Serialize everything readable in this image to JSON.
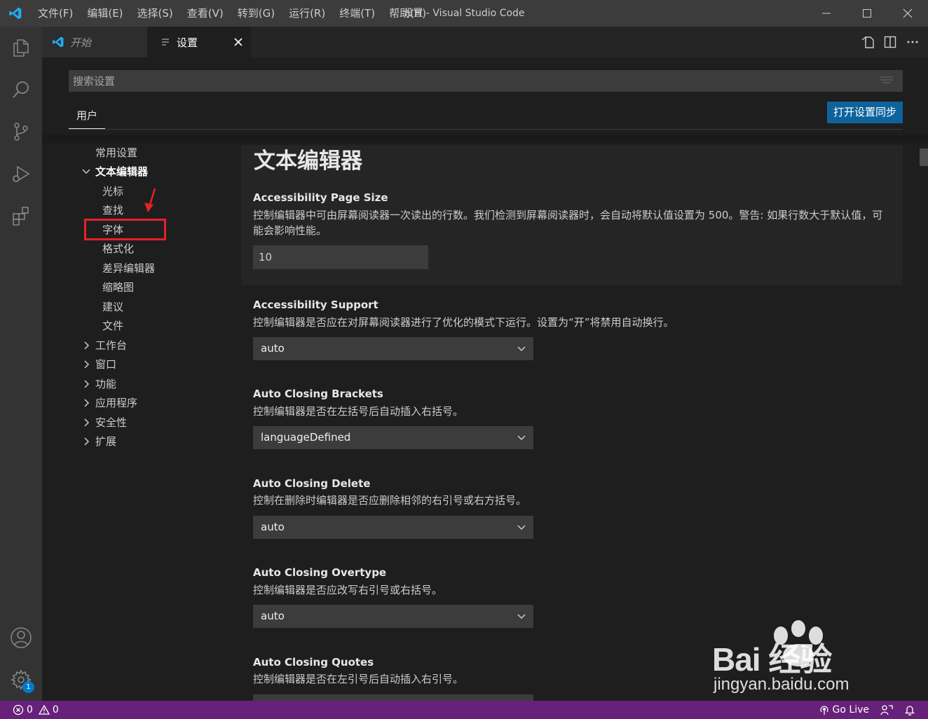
{
  "titlebar": {
    "menu": [
      "文件(F)",
      "编辑(E)",
      "选择(S)",
      "查看(V)",
      "转到(G)",
      "运行(R)",
      "终端(T)",
      "帮助(H)"
    ],
    "title": "设置 - Visual Studio Code"
  },
  "activitybar": {
    "icons": [
      "explorer-icon",
      "search-icon",
      "source-control-icon",
      "run-debug-icon",
      "extensions-icon",
      "account-icon",
      "manage-gear-icon"
    ],
    "manage_badge": "1"
  },
  "tabs": [
    {
      "label": "开始",
      "active": false
    },
    {
      "label": "设置",
      "active": true
    }
  ],
  "settings": {
    "search_placeholder": "搜索设置",
    "scope_tab": "用户",
    "sync_button": "打开设置同步",
    "toc": {
      "common": "常用设置",
      "text_editor": "文本编辑器",
      "text_editor_children": [
        "光标",
        "查找",
        "字体",
        "格式化",
        "差异编辑器",
        "缩略图",
        "建议",
        "文件"
      ],
      "collapsed": [
        "工作台",
        "窗口",
        "功能",
        "应用程序",
        "安全性",
        "扩展"
      ]
    },
    "section_title": "文本编辑器",
    "items": [
      {
        "title": "Accessibility Page Size",
        "desc": "控制编辑器中可由屏幕阅读器一次读出的行数。我们检测到屏幕阅读器时，会自动将默认值设置为 500。警告: 如果行数大于默认值，可能会影响性能。",
        "value": "10"
      },
      {
        "title": "Accessibility Support",
        "desc": "控制编辑器是否应在对屏幕阅读器进行了优化的模式下运行。设置为“开”将禁用自动换行。",
        "value": "auto"
      },
      {
        "title": "Auto Closing Brackets",
        "desc": "控制编辑器是否在左括号后自动插入右括号。",
        "value": "languageDefined"
      },
      {
        "title": "Auto Closing Delete",
        "desc": "控制在删除时编辑器是否应删除相邻的右引号或右方括号。",
        "value": "auto"
      },
      {
        "title": "Auto Closing Overtype",
        "desc": "控制编辑器是否应改写右引号或右括号。",
        "value": "auto"
      },
      {
        "title": "Auto Closing Quotes",
        "desc": "控制编辑器是否在左引号后自动插入右引号。",
        "value": ""
      }
    ]
  },
  "statusbar": {
    "errors": "0",
    "warnings": "0",
    "go_live": "Go Live"
  },
  "watermark": {
    "brand": "Bai 经验",
    "url": "jingyan.baidu.com"
  },
  "colors": {
    "accent": "#007acc",
    "statusbar": "#68217a",
    "highlight": "#e5212a"
  }
}
